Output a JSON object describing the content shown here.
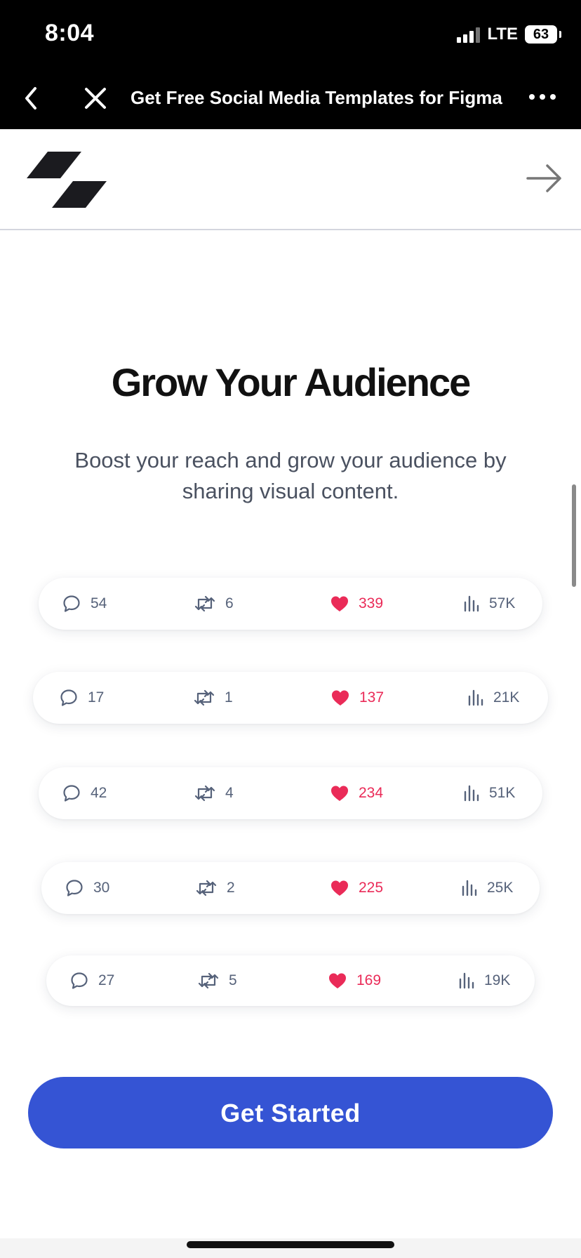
{
  "status_bar": {
    "time": "8:04",
    "network": "LTE",
    "battery": "63"
  },
  "browser": {
    "title": "Get Free Social Media Templates for Figma",
    "back_icon": "chevron-left-icon",
    "close_icon": "close-icon",
    "more_icon": "more-horizontal-icon"
  },
  "header": {
    "logo_icon": "brand-logo-icon",
    "arrow_icon": "arrow-right-icon"
  },
  "hero": {
    "title": "Grow Your Audience",
    "subtitle": "Boost your reach and grow your audience by sharing visual content."
  },
  "engagement_cards": [
    {
      "comments": "54",
      "reposts": "6",
      "likes": "339",
      "views": "57K"
    },
    {
      "comments": "17",
      "reposts": "1",
      "likes": "137",
      "views": "21K"
    },
    {
      "comments": "42",
      "reposts": "4",
      "likes": "234",
      "views": "51K"
    },
    {
      "comments": "30",
      "reposts": "2",
      "likes": "225",
      "views": "25K"
    },
    {
      "comments": "27",
      "reposts": "5",
      "likes": "169",
      "views": "19K"
    }
  ],
  "cta": {
    "label": "Get Started"
  },
  "colors": {
    "like": "#ea2b58",
    "cta": "#3554d4",
    "muted": "#56627a"
  }
}
